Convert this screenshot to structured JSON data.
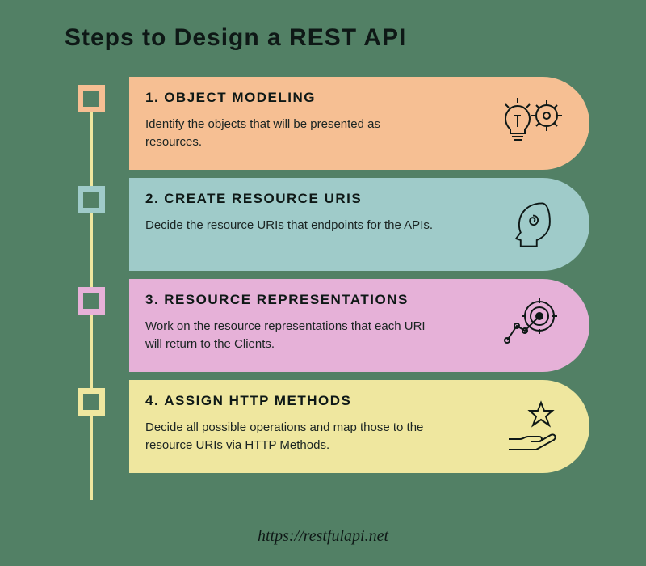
{
  "title": "Steps to Design a REST API",
  "steps": [
    {
      "num": "1.",
      "title": "OBJECT MODELING",
      "desc": "Identify the objects that will be presented as resources.",
      "icon": "lightbulb-gear-icon",
      "color": "#f6bf93"
    },
    {
      "num": "2.",
      "title": "CREATE RESOURCE URIS",
      "desc": "Decide the resource URIs that endpoints for the APIs.",
      "icon": "head-spiral-icon",
      "color": "#9fcbc9"
    },
    {
      "num": "3.",
      "title": "RESOURCE REPRESENTATIONS",
      "desc": "Work on the resource representations that each URI will return to the Clients.",
      "icon": "target-path-icon",
      "color": "#e6b1d8"
    },
    {
      "num": "4.",
      "title": "ASSIGN HTTP METHODS",
      "desc": "Decide all possible operations and map those to the resource URIs via HTTP Methods.",
      "icon": "hand-star-icon",
      "color": "#efe79f"
    }
  ],
  "footer": "https://restfulapi.net"
}
